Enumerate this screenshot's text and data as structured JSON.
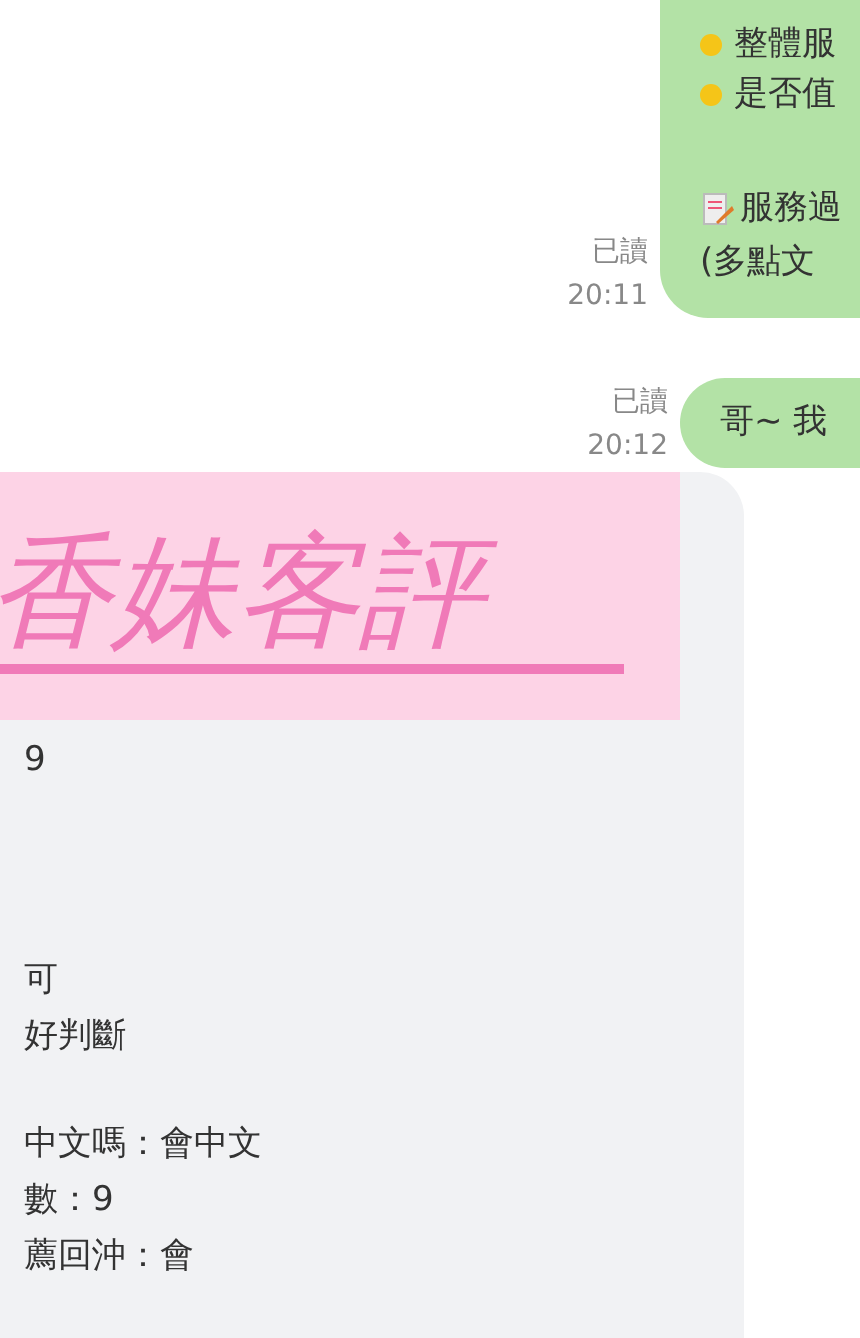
{
  "chat": {
    "sent_messages": [
      {
        "lines": [
          {
            "kind": "bullet",
            "text": "整體服"
          },
          {
            "kind": "bullet",
            "text": "是否值"
          },
          {
            "kind": "blank"
          },
          {
            "kind": "memo",
            "text": "服務過"
          },
          {
            "kind": "plain",
            "text": "(多點文"
          }
        ],
        "read_label": "已讀",
        "time": "20:11"
      },
      {
        "lines": [
          {
            "kind": "plain",
            "text": "哥~ 我"
          }
        ],
        "read_label": "已讀",
        "time": "20:12"
      }
    ],
    "received_card": {
      "banner_title": "香妹客評",
      "groups": [
        [
          "9"
        ],
        [
          "可",
          "好判斷"
        ],
        [
          "中文嗎：會中文",
          "數：9",
          "薦回沖：會"
        ]
      ]
    }
  }
}
